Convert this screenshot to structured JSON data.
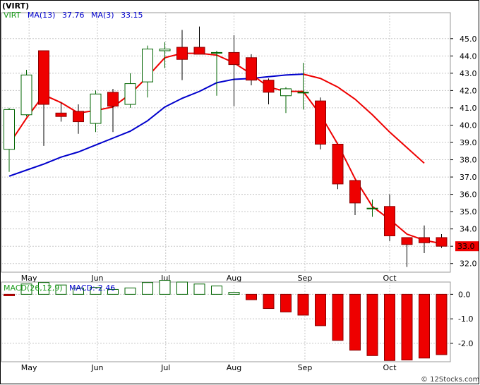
{
  "title": "(VIRT)",
  "watermark": "© 12Stocks.com",
  "chart_data": [
    {
      "type": "candlestick",
      "indicators": [
        {
          "label": "VIRT",
          "color": "#1a9c1a"
        },
        {
          "label": "MA(13)",
          "value_text": "37.76",
          "color": "#0000cc"
        },
        {
          "label": "MA(3)",
          "value_text": "33.15",
          "color": "#0000cc"
        }
      ],
      "ylim": [
        31.5,
        46.5
      ],
      "yticks": [
        "32.0",
        "33.0",
        "34.0",
        "35.0",
        "36.0",
        "37.0",
        "38.0",
        "39.0",
        "40.0",
        "41.0",
        "42.0",
        "43.0",
        "44.0",
        "45.0"
      ],
      "last_price": "33.0",
      "x_labels": [
        "May",
        "Jun",
        "Jul",
        "Aug",
        "Sep",
        "Oct"
      ],
      "x_label_positions": [
        1.15,
        5.1,
        9.05,
        13.0,
        17.1,
        22.0
      ],
      "candles": [
        {
          "o": 38.6,
          "h": 41.0,
          "l": 37.3,
          "c": 40.9
        },
        {
          "o": 40.6,
          "h": 43.2,
          "l": 40.5,
          "c": 42.9
        },
        {
          "o": 44.3,
          "h": 44.3,
          "l": 38.8,
          "c": 41.2
        },
        {
          "o": 40.7,
          "h": 41.3,
          "l": 40.2,
          "c": 40.5
        },
        {
          "o": 40.8,
          "h": 41.2,
          "l": 39.5,
          "c": 40.2
        },
        {
          "o": 40.1,
          "h": 42.0,
          "l": 39.6,
          "c": 41.8
        },
        {
          "o": 41.9,
          "h": 42.1,
          "l": 39.6,
          "c": 41.1
        },
        {
          "o": 41.2,
          "h": 43.0,
          "l": 41.0,
          "c": 42.4
        },
        {
          "o": 42.5,
          "h": 44.6,
          "l": 41.6,
          "c": 44.4
        },
        {
          "o": 44.3,
          "h": 44.8,
          "l": 43.3,
          "c": 44.4
        },
        {
          "o": 44.5,
          "h": 45.5,
          "l": 42.6,
          "c": 43.8
        },
        {
          "o": 44.5,
          "h": 45.7,
          "l": 44.2,
          "c": 44.1
        },
        {
          "o": 44.2,
          "h": 44.3,
          "l": 41.7,
          "c": 44.2
        },
        {
          "o": 44.2,
          "h": 45.2,
          "l": 41.1,
          "c": 43.5
        },
        {
          "o": 43.9,
          "h": 44.1,
          "l": 42.3,
          "c": 42.6
        },
        {
          "o": 42.6,
          "h": 42.7,
          "l": 41.2,
          "c": 41.9
        },
        {
          "o": 41.7,
          "h": 42.2,
          "l": 40.7,
          "c": 42.1
        },
        {
          "o": 41.9,
          "h": 43.6,
          "l": 40.9,
          "c": 41.9
        },
        {
          "o": 41.4,
          "h": 41.6,
          "l": 38.6,
          "c": 38.9
        },
        {
          "o": 38.9,
          "h": 38.9,
          "l": 36.3,
          "c": 36.6
        },
        {
          "o": 36.8,
          "h": 36.8,
          "l": 34.8,
          "c": 35.5
        },
        {
          "o": 35.2,
          "h": 35.7,
          "l": 34.7,
          "c": 35.2
        },
        {
          "o": 35.3,
          "h": 36.0,
          "l": 33.3,
          "c": 33.6
        },
        {
          "o": 33.5,
          "h": 33.5,
          "l": 31.8,
          "c": 33.1
        },
        {
          "o": 33.5,
          "h": 34.2,
          "l": 32.6,
          "c": 33.2
        },
        {
          "o": 33.5,
          "h": 33.7,
          "l": 32.9,
          "c": 33.0
        }
      ],
      "ma13": [
        {
          "x": 0,
          "y": 37.05
        },
        {
          "x": 1,
          "y": 37.4
        },
        {
          "x": 2,
          "y": 37.75
        },
        {
          "x": 3,
          "y": 38.15
        },
        {
          "x": 4,
          "y": 38.45
        },
        {
          "x": 5,
          "y": 38.85
        },
        {
          "x": 6,
          "y": 39.25
        },
        {
          "x": 7,
          "y": 39.65
        },
        {
          "x": 8,
          "y": 40.25
        },
        {
          "x": 9,
          "y": 41.05
        },
        {
          "x": 10,
          "y": 41.55
        },
        {
          "x": 11,
          "y": 41.95
        },
        {
          "x": 12,
          "y": 42.45
        },
        {
          "x": 13,
          "y": 42.65
        },
        {
          "x": 14,
          "y": 42.7
        },
        {
          "x": 15,
          "y": 42.8
        },
        {
          "x": 16,
          "y": 42.9
        },
        {
          "x": 17,
          "y": 42.95
        }
      ],
      "ma3": [
        {
          "x": 0,
          "y": 38.9
        },
        {
          "x": 1,
          "y": 40.4
        },
        {
          "x": 2,
          "y": 41.75
        },
        {
          "x": 3,
          "y": 41.3
        },
        {
          "x": 4,
          "y": 40.7
        },
        {
          "x": 5,
          "y": 40.85
        },
        {
          "x": 6,
          "y": 41.05
        },
        {
          "x": 7,
          "y": 41.8
        },
        {
          "x": 8,
          "y": 42.8
        },
        {
          "x": 9,
          "y": 43.9
        },
        {
          "x": 10,
          "y": 44.15
        },
        {
          "x": 11,
          "y": 44.15
        },
        {
          "x": 12,
          "y": 44.05
        },
        {
          "x": 13,
          "y": 43.6
        },
        {
          "x": 14,
          "y": 42.95
        },
        {
          "x": 15,
          "y": 42.2
        },
        {
          "x": 16,
          "y": 41.95
        },
        {
          "x": 17,
          "y": 41.95
        },
        {
          "x": 18,
          "y": 40.6
        },
        {
          "x": 19,
          "y": 38.9
        },
        {
          "x": 20,
          "y": 36.9
        },
        {
          "x": 21,
          "y": 35.3
        },
        {
          "x": 22,
          "y": 34.55
        },
        {
          "x": 23,
          "y": 33.7
        },
        {
          "x": 24,
          "y": 33.35
        },
        {
          "x": 25,
          "y": 33.15
        }
      ],
      "ma_long": [
        {
          "x": 17,
          "y": 42.95
        },
        {
          "x": 18,
          "y": 42.7
        },
        {
          "x": 19,
          "y": 42.2
        },
        {
          "x": 20,
          "y": 41.5
        },
        {
          "x": 21,
          "y": 40.6
        },
        {
          "x": 22,
          "y": 39.6
        },
        {
          "x": 23,
          "y": 38.7
        },
        {
          "x": 24,
          "y": 37.8
        }
      ]
    },
    {
      "type": "bar",
      "indicators": [
        {
          "label": "MACD(26,12,9)",
          "color": "#1a9c1a"
        },
        {
          "label": "MACD:-2.46",
          "color": "#0000cc"
        }
      ],
      "ylim": [
        -2.75,
        0.5
      ],
      "yticks": [
        "0.0",
        "-1.0",
        "-2.0"
      ],
      "x_labels": [
        "May",
        "Jun",
        "Jul",
        "Aug",
        "Sep",
        "Oct"
      ],
      "x_label_positions": [
        1.15,
        5.1,
        9.05,
        13.0,
        17.1,
        22.0
      ],
      "values": [
        -0.06,
        0.42,
        0.48,
        0.38,
        0.25,
        0.28,
        0.2,
        0.26,
        0.48,
        0.57,
        0.5,
        0.42,
        0.34,
        0.08,
        -0.22,
        -0.58,
        -0.72,
        -0.85,
        -1.28,
        -1.88,
        -2.28,
        -2.5,
        -2.7,
        -2.68,
        -2.6,
        -2.46
      ]
    }
  ]
}
